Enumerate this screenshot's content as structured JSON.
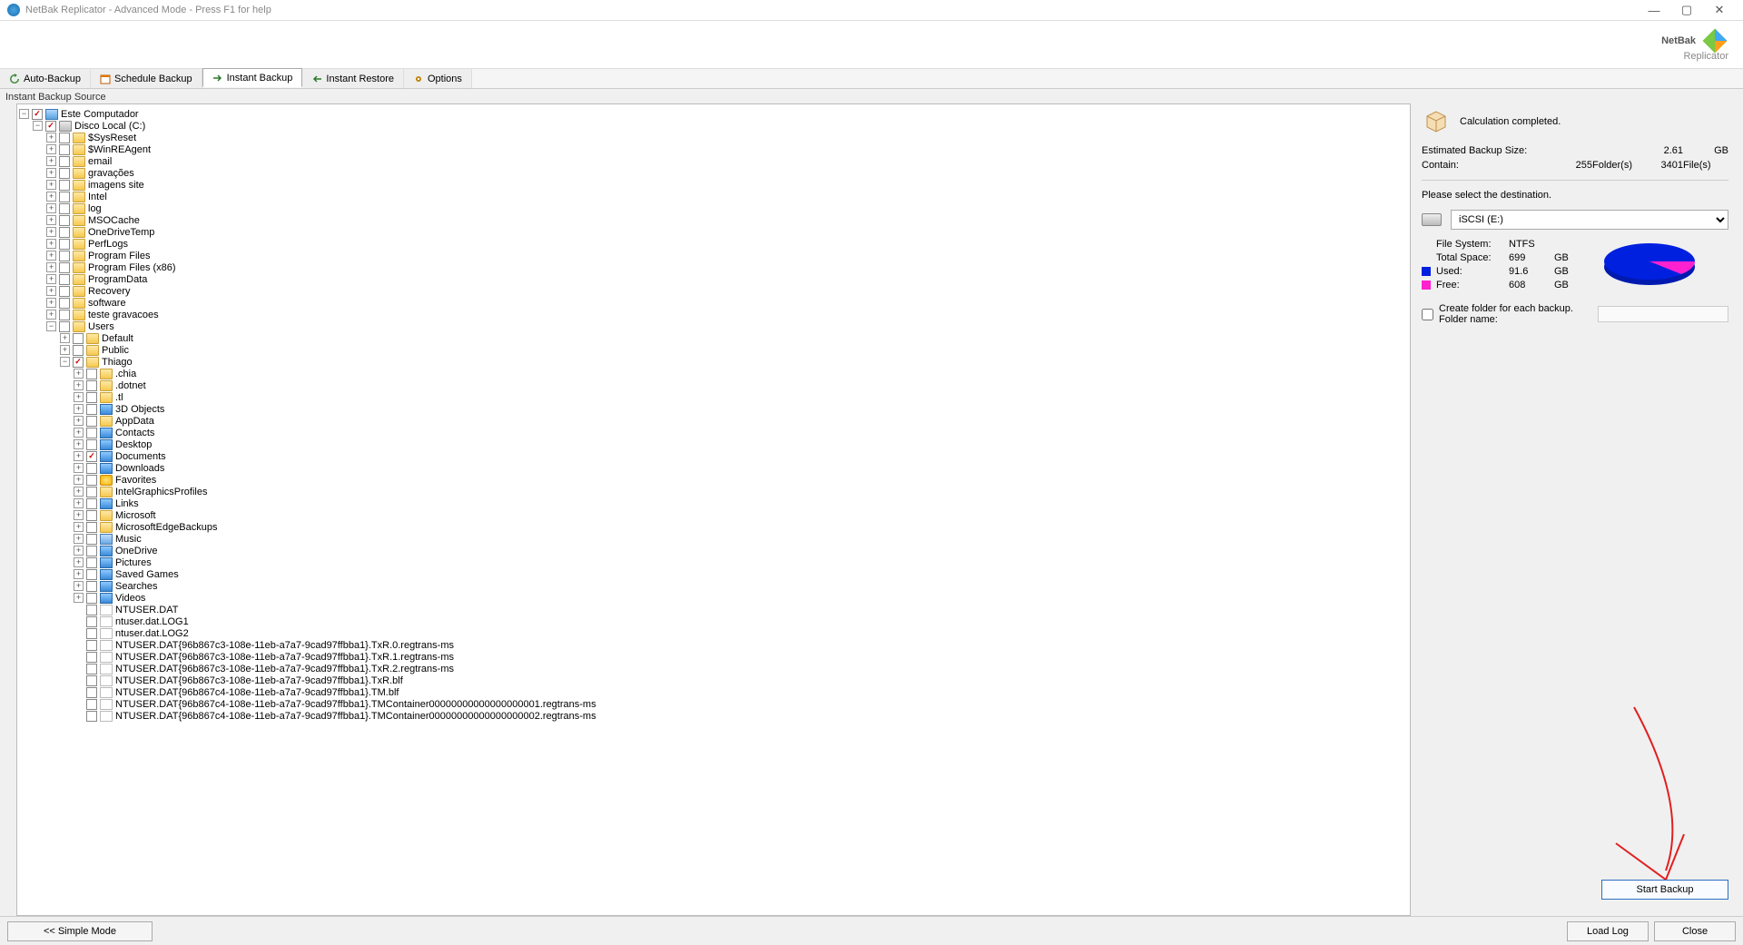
{
  "window": {
    "title": "NetBak Replicator - Advanced Mode - Press F1 for help"
  },
  "logo": {
    "brand1": "NetBak",
    "brand2": "Replicator"
  },
  "tabs": {
    "auto": "Auto-Backup",
    "schedule": "Schedule Backup",
    "instant": "Instant Backup",
    "restore": "Instant Restore",
    "options": "Options"
  },
  "subtitle": "Instant Backup Source",
  "tree": {
    "root": "Este Computador",
    "drive": "Disco Local (C:)",
    "level1": [
      "$SysReset",
      "$WinREAgent",
      "email",
      "gravações",
      "imagens site",
      "Intel",
      "log",
      "MSOCache",
      "OneDriveTemp",
      "PerfLogs",
      "Program Files",
      "Program Files (x86)",
      "ProgramData",
      "Recovery",
      "software",
      "teste gravacoes",
      "Users"
    ],
    "users": [
      "Default",
      "Public",
      "Thiago"
    ],
    "thiago": [
      {
        "n": ".chia",
        "t": "folder"
      },
      {
        "n": ".dotnet",
        "t": "folder"
      },
      {
        "n": ".tl",
        "t": "folder"
      },
      {
        "n": "3D Objects",
        "t": "blue"
      },
      {
        "n": "AppData",
        "t": "folder"
      },
      {
        "n": "Contacts",
        "t": "blue"
      },
      {
        "n": "Desktop",
        "t": "blue"
      },
      {
        "n": "Documents",
        "t": "blue",
        "checked": true
      },
      {
        "n": "Downloads",
        "t": "blue"
      },
      {
        "n": "Favorites",
        "t": "star"
      },
      {
        "n": "IntelGraphicsProfiles",
        "t": "folder"
      },
      {
        "n": "Links",
        "t": "blue"
      },
      {
        "n": "Microsoft",
        "t": "folder"
      },
      {
        "n": "MicrosoftEdgeBackups",
        "t": "folder"
      },
      {
        "n": "Music",
        "t": "music"
      },
      {
        "n": "OneDrive",
        "t": "blue"
      },
      {
        "n": "Pictures",
        "t": "blue"
      },
      {
        "n": "Saved Games",
        "t": "blue"
      },
      {
        "n": "Searches",
        "t": "blue"
      },
      {
        "n": "Videos",
        "t": "blue"
      },
      {
        "n": "NTUSER.DAT",
        "t": "file"
      },
      {
        "n": "ntuser.dat.LOG1",
        "t": "file"
      },
      {
        "n": "ntuser.dat.LOG2",
        "t": "file"
      },
      {
        "n": "NTUSER.DAT{96b867c3-108e-11eb-a7a7-9cad97ffbba1}.TxR.0.regtrans-ms",
        "t": "file"
      },
      {
        "n": "NTUSER.DAT{96b867c3-108e-11eb-a7a7-9cad97ffbba1}.TxR.1.regtrans-ms",
        "t": "file"
      },
      {
        "n": "NTUSER.DAT{96b867c3-108e-11eb-a7a7-9cad97ffbba1}.TxR.2.regtrans-ms",
        "t": "file"
      },
      {
        "n": "NTUSER.DAT{96b867c3-108e-11eb-a7a7-9cad97ffbba1}.TxR.blf",
        "t": "file"
      },
      {
        "n": "NTUSER.DAT{96b867c4-108e-11eb-a7a7-9cad97ffbba1}.TM.blf",
        "t": "file"
      },
      {
        "n": "NTUSER.DAT{96b867c4-108e-11eb-a7a7-9cad97ffbba1}.TMContainer00000000000000000001.regtrans-ms",
        "t": "file"
      },
      {
        "n": "NTUSER.DAT{96b867c4-108e-11eb-a7a7-9cad97ffbba1}.TMContainer00000000000000000002.regtrans-ms",
        "t": "file"
      }
    ]
  },
  "calc": {
    "status": "Calculation completed.",
    "est_label": "Estimated Backup Size:",
    "est_val": "2.61",
    "est_unit": "GB",
    "contain_label": "Contain:",
    "folders_n": "255",
    "folders_l": "Folder(s)",
    "files_n": "3401",
    "files_l": "File(s)"
  },
  "dest": {
    "prompt": "Please select the destination.",
    "selected": "iSCSI (E:)",
    "fs_label": "File System:",
    "fs_val": "NTFS",
    "total_label": "Total Space:",
    "total_val": "699",
    "total_unit": "GB",
    "used_label": "Used:",
    "used_val": "91.6",
    "used_unit": "GB",
    "free_label": "Free:",
    "free_val": "608",
    "free_unit": "GB"
  },
  "folder_opt": {
    "label": "Create folder for each backup. Folder name:"
  },
  "buttons": {
    "start": "Start Backup",
    "simple": "<<  Simple Mode",
    "loadlog": "Load Log",
    "close": "Close"
  }
}
